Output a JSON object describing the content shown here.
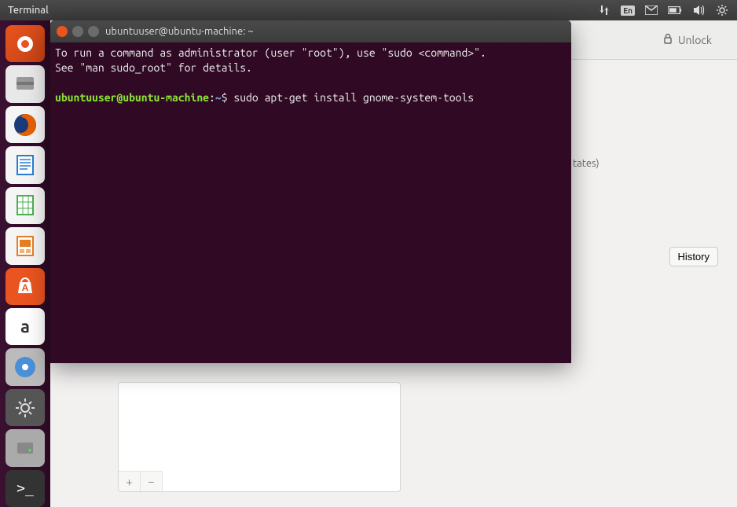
{
  "menubar": {
    "title": "Terminal",
    "keyboard_indicator": "En"
  },
  "launcher": {
    "items": [
      {
        "name": "dash",
        "glyph": "◉"
      },
      {
        "name": "files",
        "glyph": "🗄"
      },
      {
        "name": "firefox",
        "glyph": "🦊"
      },
      {
        "name": "writer",
        "glyph": "📄"
      },
      {
        "name": "calc",
        "glyph": "📊"
      },
      {
        "name": "impress",
        "glyph": "📽"
      },
      {
        "name": "software",
        "glyph": "A"
      },
      {
        "name": "amazon",
        "glyph": "a"
      },
      {
        "name": "disc",
        "glyph": "💿"
      },
      {
        "name": "settings",
        "glyph": "⚙"
      },
      {
        "name": "disk",
        "glyph": "💽"
      },
      {
        "name": "terminal",
        "glyph": ">_"
      }
    ]
  },
  "background_app": {
    "unlock_label": "Unlock",
    "partial_text": "tates)",
    "history_label": "History",
    "add_label": "+",
    "remove_label": "−"
  },
  "terminal": {
    "title": "ubuntuuser@ubuntu-machine: ~",
    "output_line1": "To run a command as administrator (user \"root\"), use \"sudo <command>\".",
    "output_line2": "See \"man sudo_root\" for details.",
    "prompt_user": "ubuntuuser@ubuntu-machine",
    "prompt_sep1": ":",
    "prompt_path": "~",
    "prompt_sep2": "$ ",
    "command": "sudo apt-get install gnome-system-tools"
  }
}
